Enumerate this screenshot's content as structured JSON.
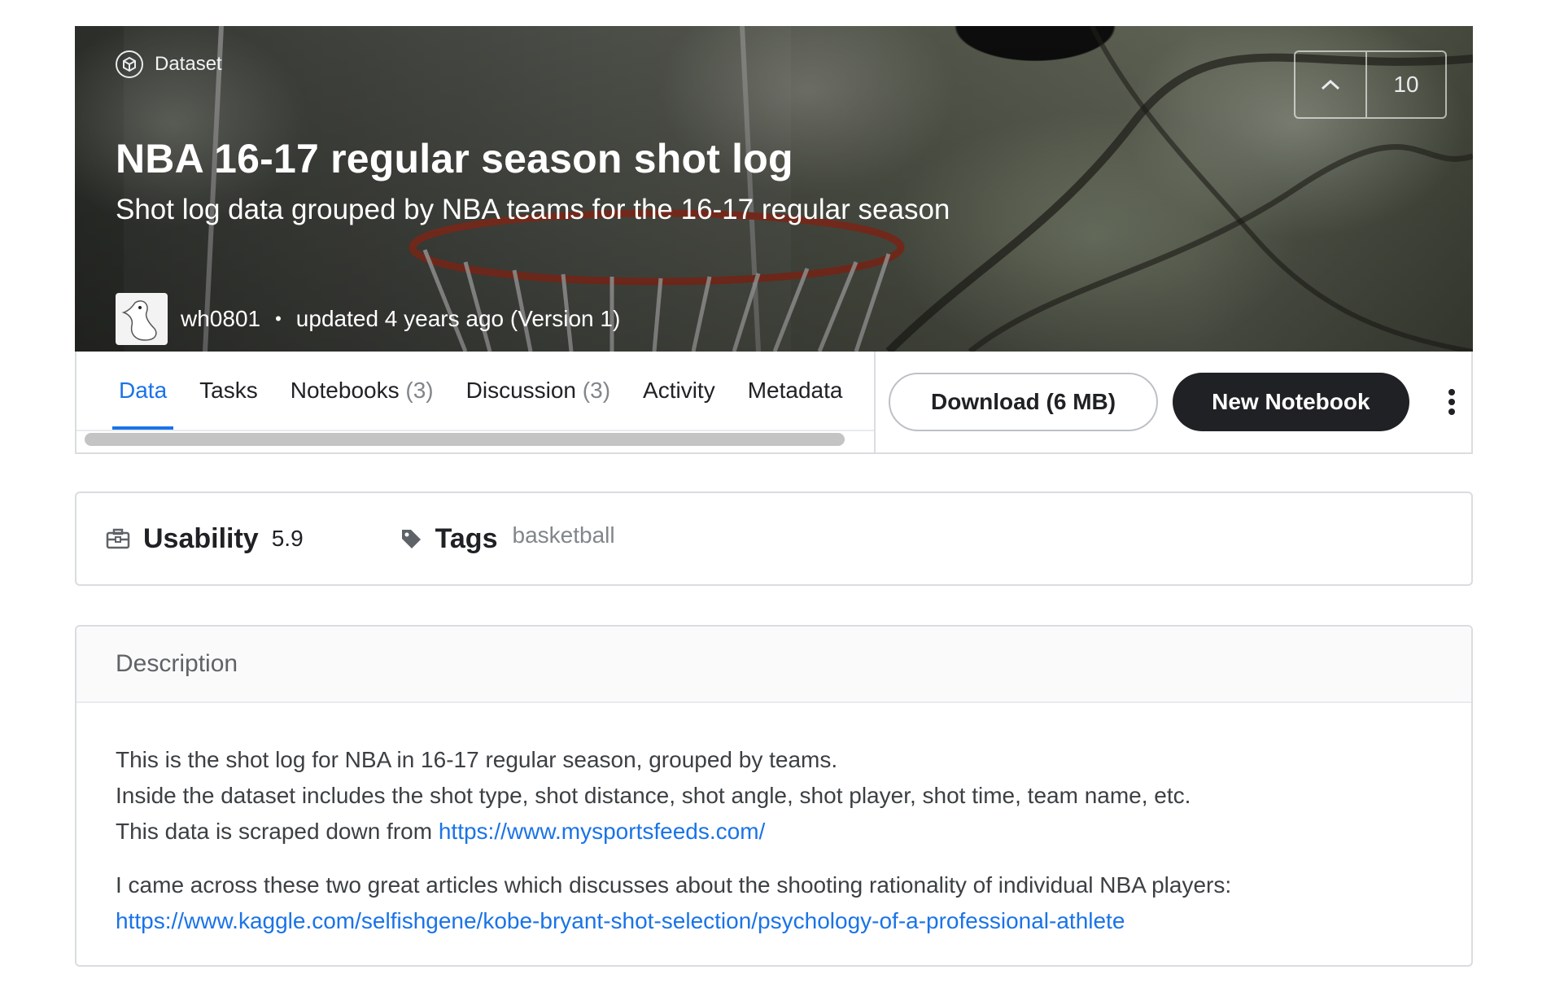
{
  "hero": {
    "badge_label": "Dataset",
    "vote_count": "10",
    "title": "NBA 16-17 regular season shot log",
    "subtitle": "Shot log data grouped by NBA teams for the 16-17 regular season",
    "owner": "wh0801",
    "separator": "•",
    "updated": "updated 4 years ago (Version 1)"
  },
  "tabs": [
    {
      "label": "Data",
      "count": ""
    },
    {
      "label": "Tasks",
      "count": ""
    },
    {
      "label": "Notebooks",
      "count": "(3)"
    },
    {
      "label": "Discussion",
      "count": "(3)"
    },
    {
      "label": "Activity",
      "count": ""
    },
    {
      "label": "Metadata",
      "count": ""
    }
  ],
  "actions": {
    "download_label": "Download (6 MB)",
    "new_notebook_label": "New Notebook"
  },
  "usability": {
    "label": "Usability",
    "value": "5.9",
    "tags_label": "Tags",
    "tag": "basketball"
  },
  "description": {
    "heading": "Description",
    "line1": "This is the shot log for NBA in 16-17 regular season, grouped by teams.",
    "line2": "Inside the dataset includes the shot type, shot distance, shot angle, shot player, shot time, team name, etc.",
    "line3_prefix": "This data is scraped down from ",
    "line3_link": "https://www.mysportsfeeds.com/",
    "line4": "I came across these two great articles which discusses about the shooting rationality of individual NBA players:",
    "line5_link": "https://www.kaggle.com/selfishgene/kobe-bryant-shot-selection/psychology-of-a-professional-athlete"
  },
  "colors": {
    "accent": "#1a73e8",
    "button_dark": "#202124",
    "border": "#dadce0"
  },
  "icons": [
    "dataset-icon",
    "chevron-up-icon",
    "usability-icon",
    "tag-icon",
    "kebab-menu-icon"
  ]
}
